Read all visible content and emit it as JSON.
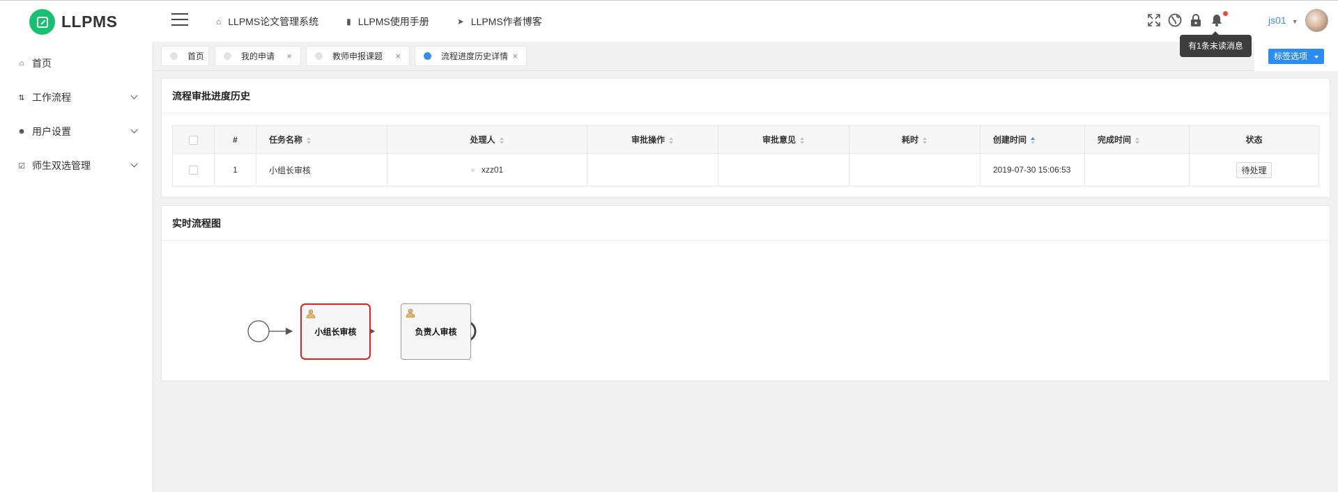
{
  "app": {
    "logo_text": "LLPMS"
  },
  "topnav": [
    {
      "icon": "home-icon",
      "label": "LLPMS论文管理系统"
    },
    {
      "icon": "file-icon",
      "label": "LLPMS使用手册"
    },
    {
      "icon": "paper-plane-icon",
      "label": "LLPMS作者博客"
    }
  ],
  "header": {
    "icons": [
      "fullscreen-icon",
      "globe-icon",
      "lock-icon",
      "bell-icon"
    ],
    "user": "js01",
    "notification_tooltip": "有1条未读消息",
    "notification_dot_color": "#f04a2a"
  },
  "sidebar": {
    "items": [
      {
        "icon": "home-icon",
        "label": "首页"
      },
      {
        "icon": "workflow-icon",
        "label": "工作流程"
      },
      {
        "icon": "user-circle-icon",
        "label": "用户设置"
      },
      {
        "icon": "checkbox-icon",
        "label": "师生双选管理"
      }
    ]
  },
  "tabs": [
    {
      "label": "首页",
      "closable": false,
      "active": false
    },
    {
      "label": "我的申请",
      "closable": true,
      "active": false
    },
    {
      "label": "教师申报课题",
      "closable": true,
      "active": false
    },
    {
      "label": "流程进度历史详情",
      "closable": true,
      "active": true
    }
  ],
  "tab_options_label": "标签选项",
  "history_panel": {
    "title": "流程审批进度历史",
    "columns": [
      "#",
      "任务名称",
      "处理人",
      "审批操作",
      "审批意见",
      "耗时",
      "创建时间",
      "完成时间",
      "状态"
    ],
    "rows": [
      {
        "index": "1",
        "task": "小组长审核",
        "handler": "xzz01",
        "action": "",
        "comment": "",
        "duration": "",
        "created": "2019-07-30 15:06:53",
        "completed": "",
        "status": "待处理"
      }
    ]
  },
  "flow_panel": {
    "title": "实时流程图",
    "tasks": [
      {
        "label": "小组长审核",
        "current": true
      },
      {
        "label": "负责人审核",
        "current": false
      }
    ]
  },
  "colors": {
    "accent": "#3c8dde",
    "primary_button": "#2d8cf0",
    "logo": "#1ac06f",
    "current_task": "#e02020"
  }
}
